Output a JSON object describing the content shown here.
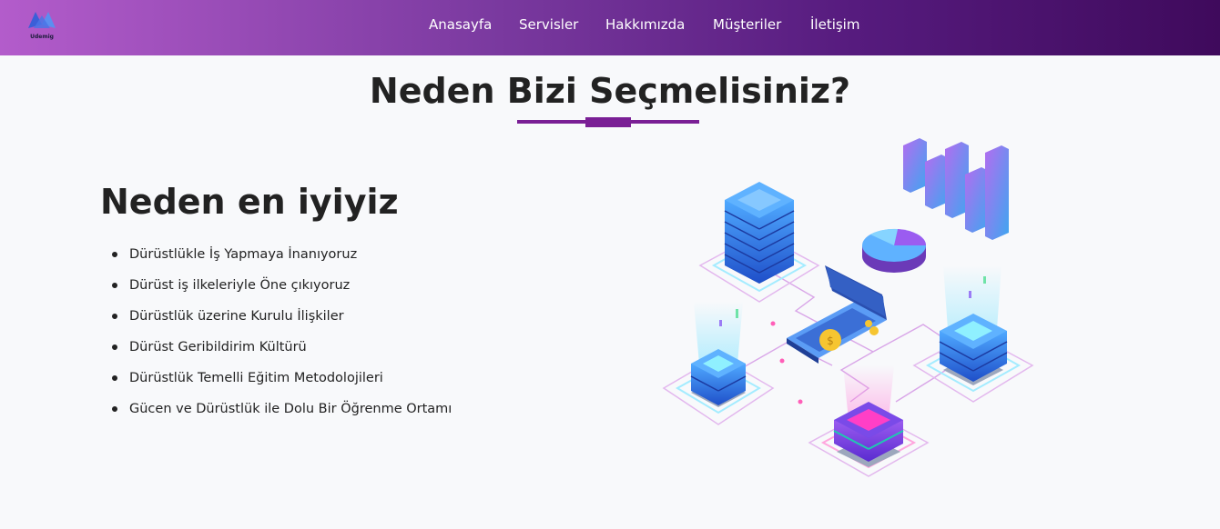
{
  "header": {
    "logo_text": "Udemig",
    "nav": [
      "Anasayfa",
      "Servisler",
      "Hakkımızda",
      "Müşteriler",
      "İletişim"
    ]
  },
  "section": {
    "title": "Neden Bizi Seçmelisiniz?",
    "heading": "Neden en iyiyiz",
    "reasons": [
      "Dürüstlükle İş Yapmaya İnanıyoruz",
      "Dürüst iş ilkeleriyle Öne çıkıyoruz",
      "Dürüstlük üzerine Kurulu İlişkiler",
      "Dürüst Geribildirim Kültürü",
      "Dürüstlük Temelli Eğitim Metodolojileri",
      "Gücen ve Dürüstlük ile Dolu Bir Öğrenme Ortamı"
    ]
  },
  "colors": {
    "nav_gradient_start": "#b35ccb",
    "nav_gradient_end": "#3f0a5c",
    "accent": "#7a1f95"
  },
  "illustration": {
    "icon": "server-network-isometric-illustration"
  }
}
